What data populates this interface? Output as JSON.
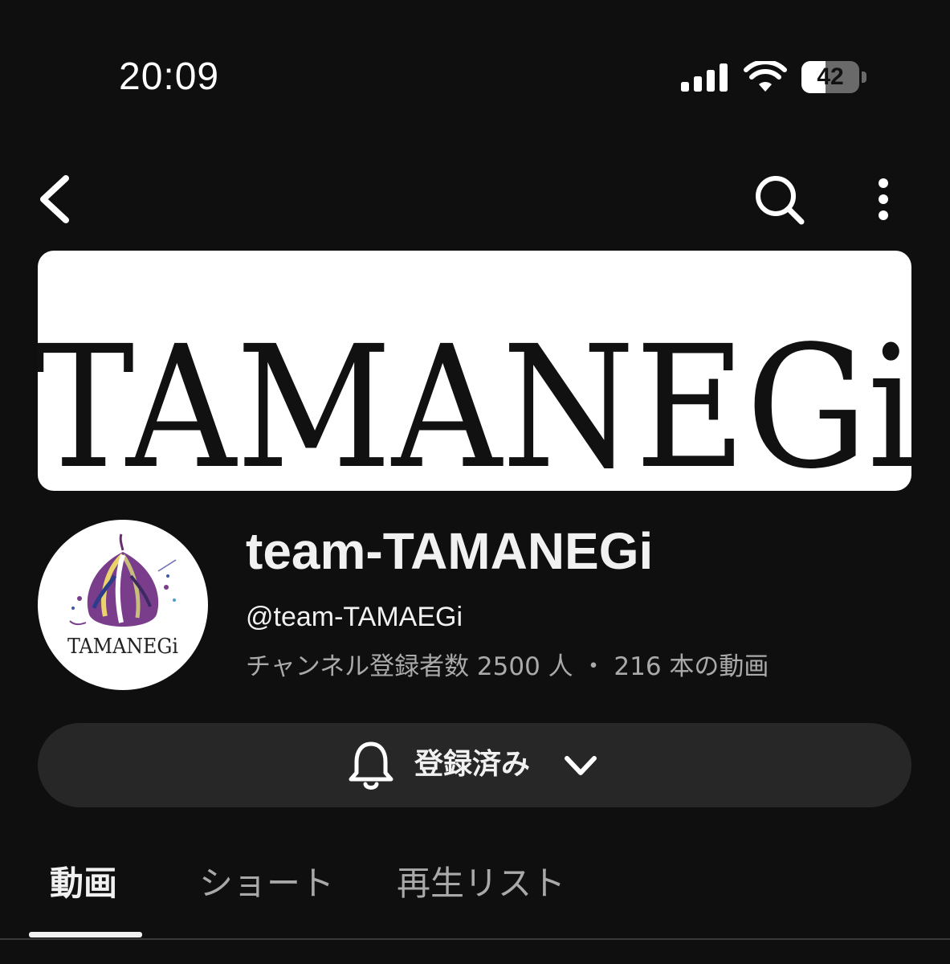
{
  "status_bar": {
    "time": "20:09",
    "battery_percent": "42",
    "battery_level": 0.42
  },
  "nav": {
    "back_icon": "chevron-left-icon",
    "search_icon": "search-icon",
    "more_icon": "more-vertical-icon"
  },
  "banner": {
    "logo_text": "TAMANEGi"
  },
  "channel": {
    "avatar_text": "TAMANEGi",
    "name": "team-TAMANEGi",
    "handle": "@team-TAMAEGi",
    "meta": "チャンネル登録者数 2500 人 ・ 216 本の動画"
  },
  "subscribe": {
    "label": "登録済み",
    "bell_icon": "bell-icon",
    "dropdown_icon": "chevron-down-icon"
  },
  "tabs": [
    {
      "label": "動画",
      "active": true
    },
    {
      "label": "ショート",
      "active": false
    },
    {
      "label": "再生リスト",
      "active": false
    }
  ],
  "colors": {
    "background": "#0f0f0f",
    "text_primary": "#f1f1f1",
    "text_secondary": "#aaaaaa",
    "button_bg": "#272727",
    "banner_bg": "#ffffff"
  }
}
